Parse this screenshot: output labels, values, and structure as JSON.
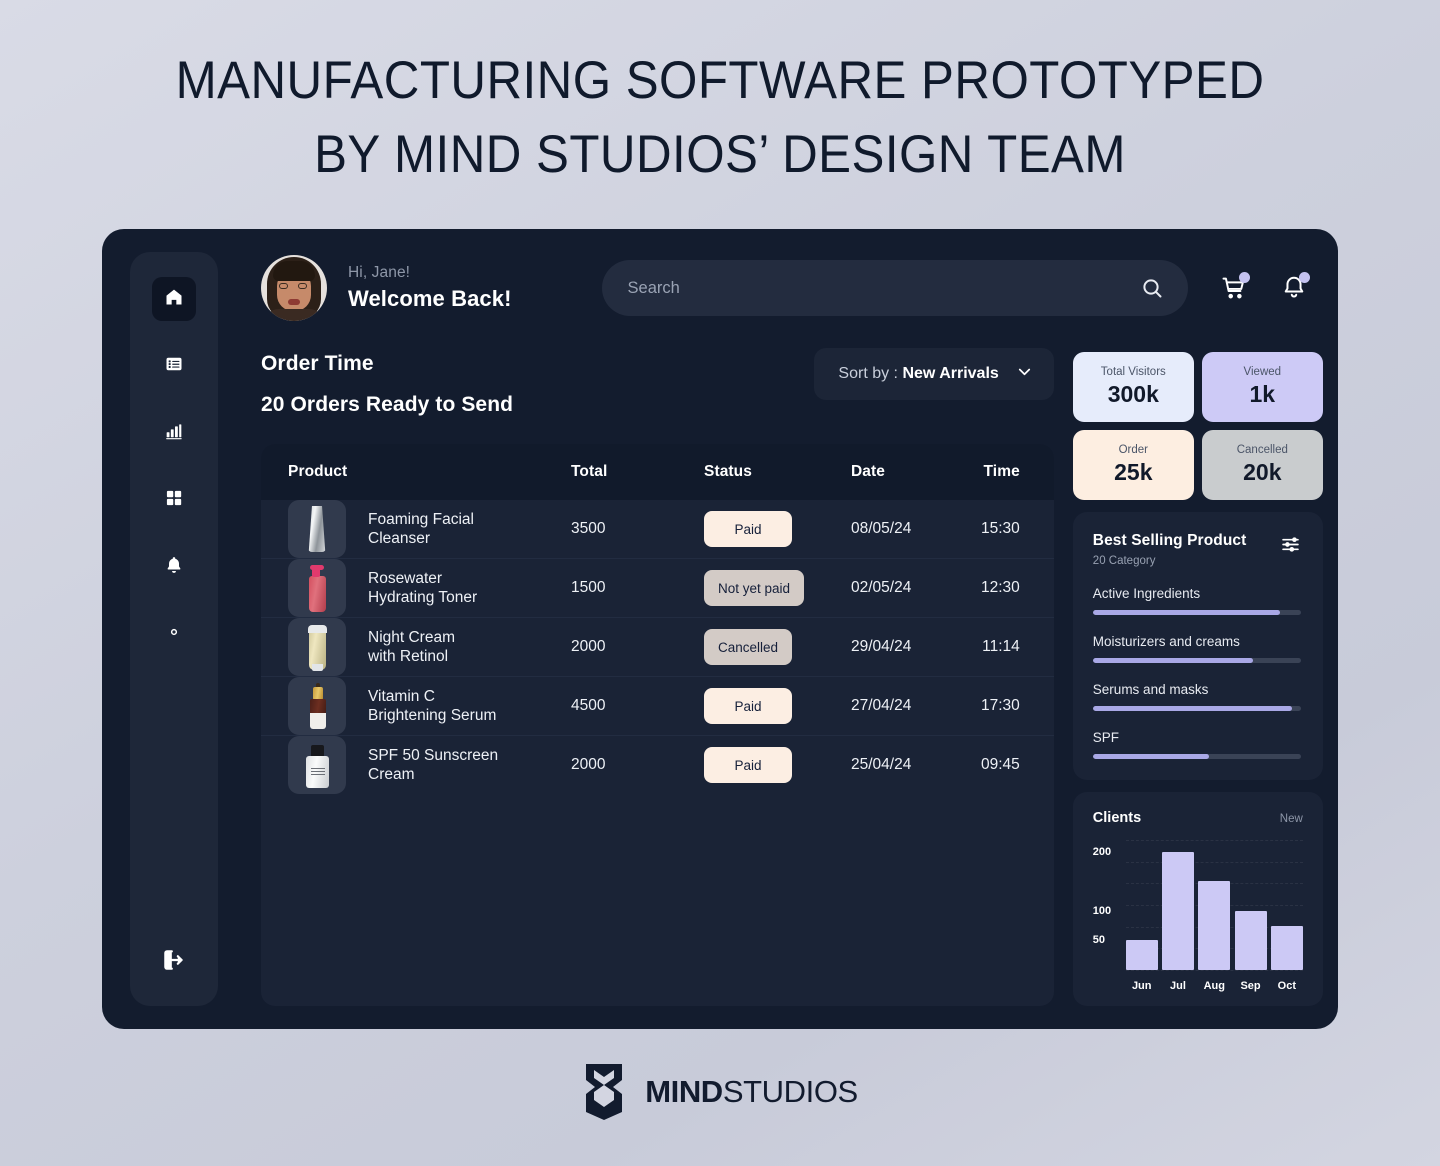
{
  "heading": {
    "line1": "MANUFACTURING SOFTWARE PROTOTYPED",
    "line2": "BY MIND STUDIOS’ DESIGN TEAM"
  },
  "sidebar": {
    "items": [
      {
        "icon": "home-icon",
        "active": true
      },
      {
        "icon": "list-icon",
        "active": false
      },
      {
        "icon": "bar-chart-icon",
        "active": false
      },
      {
        "icon": "grid-icon",
        "active": false
      },
      {
        "icon": "bell-icon",
        "active": false
      },
      {
        "icon": "gear-icon",
        "active": false
      }
    ],
    "logout_icon": "logout-icon"
  },
  "topbar": {
    "greeting": "Hi, Jane!",
    "welcome": "Welcome Back!",
    "avatar_name": "jane-avatar",
    "search_placeholder": "Search",
    "search_value": "",
    "search_icon": "search-icon",
    "cart_icon": "cart-icon",
    "bell_icon": "bell-icon"
  },
  "orders": {
    "title": "Order Time",
    "subtitle": "20 Orders Ready to Send",
    "sort": {
      "label": "Sort by :",
      "value": "New Arrivals",
      "chevron_icon": "chevron-down-icon"
    },
    "columns": [
      "Product",
      "Total",
      "Status",
      "Date",
      "Time"
    ],
    "rows": [
      {
        "product": "Foaming Facial\nCleanser",
        "total": "3500",
        "status": "Paid",
        "status_type": "paid",
        "date": "08/05/24",
        "time": "15:30",
        "thumb": "cleanser-tube"
      },
      {
        "product": "Rosewater\nHydrating Toner",
        "total": "1500",
        "status": "Not yet paid",
        "status_type": "unpaid",
        "date": "02/05/24",
        "time": "12:30",
        "thumb": "toner-pump"
      },
      {
        "product": "Night Cream\nwith Retinol",
        "total": "2000",
        "status": "Cancelled",
        "status_type": "cancelled",
        "date": "29/04/24",
        "time": "11:14",
        "thumb": "cream-tube"
      },
      {
        "product": "Vitamin C\nBrightening Serum",
        "total": "4500",
        "status": "Paid",
        "status_type": "paid",
        "date": "27/04/24",
        "time": "17:30",
        "thumb": "serum-bottle"
      },
      {
        "product": "SPF 50 Sunscreen\nCream",
        "total": "2000",
        "status": "Paid",
        "status_type": "paid",
        "date": "25/04/24",
        "time": "09:45",
        "thumb": "spf-bottle"
      }
    ]
  },
  "stats": [
    {
      "label": "Total Visitors",
      "value": "300k",
      "color": "#e6ecfb"
    },
    {
      "label": "Viewed",
      "value": "1k",
      "color": "#cdcaf6"
    },
    {
      "label": "Order",
      "value": "25k",
      "color": "#fdeee1"
    },
    {
      "label": "Cancelled",
      "value": "20k",
      "color": "#c9ccce"
    }
  ],
  "best_selling": {
    "title": "Best Selling Product",
    "subtitle": "20 Category",
    "filter_icon": "sliders-icon",
    "categories": [
      {
        "name": "Active Ingredients",
        "percent": 90
      },
      {
        "name": "Moisturizers and creams",
        "percent": 77
      },
      {
        "name": "Serums and masks",
        "percent": 96
      },
      {
        "name": "SPF",
        "percent": 56
      }
    ],
    "bar_color": "#a9a8e6"
  },
  "chart_data": {
    "type": "bar",
    "title": "Clients",
    "action_label": "New",
    "categories": [
      "Jun",
      "Jul",
      "Aug",
      "Sep",
      "Oct"
    ],
    "values": [
      50,
      200,
      150,
      100,
      75
    ],
    "yticks": [
      200,
      100,
      50
    ],
    "ylim": [
      0,
      220
    ],
    "xlabel": "",
    "ylabel": "",
    "grid": true,
    "legend": "none",
    "bar_color": "#ccc9f5"
  },
  "footer": {
    "logo_mark": "mind-studios-logo-icon",
    "logo_bold": "MIND",
    "logo_light": "STUDIOS"
  }
}
